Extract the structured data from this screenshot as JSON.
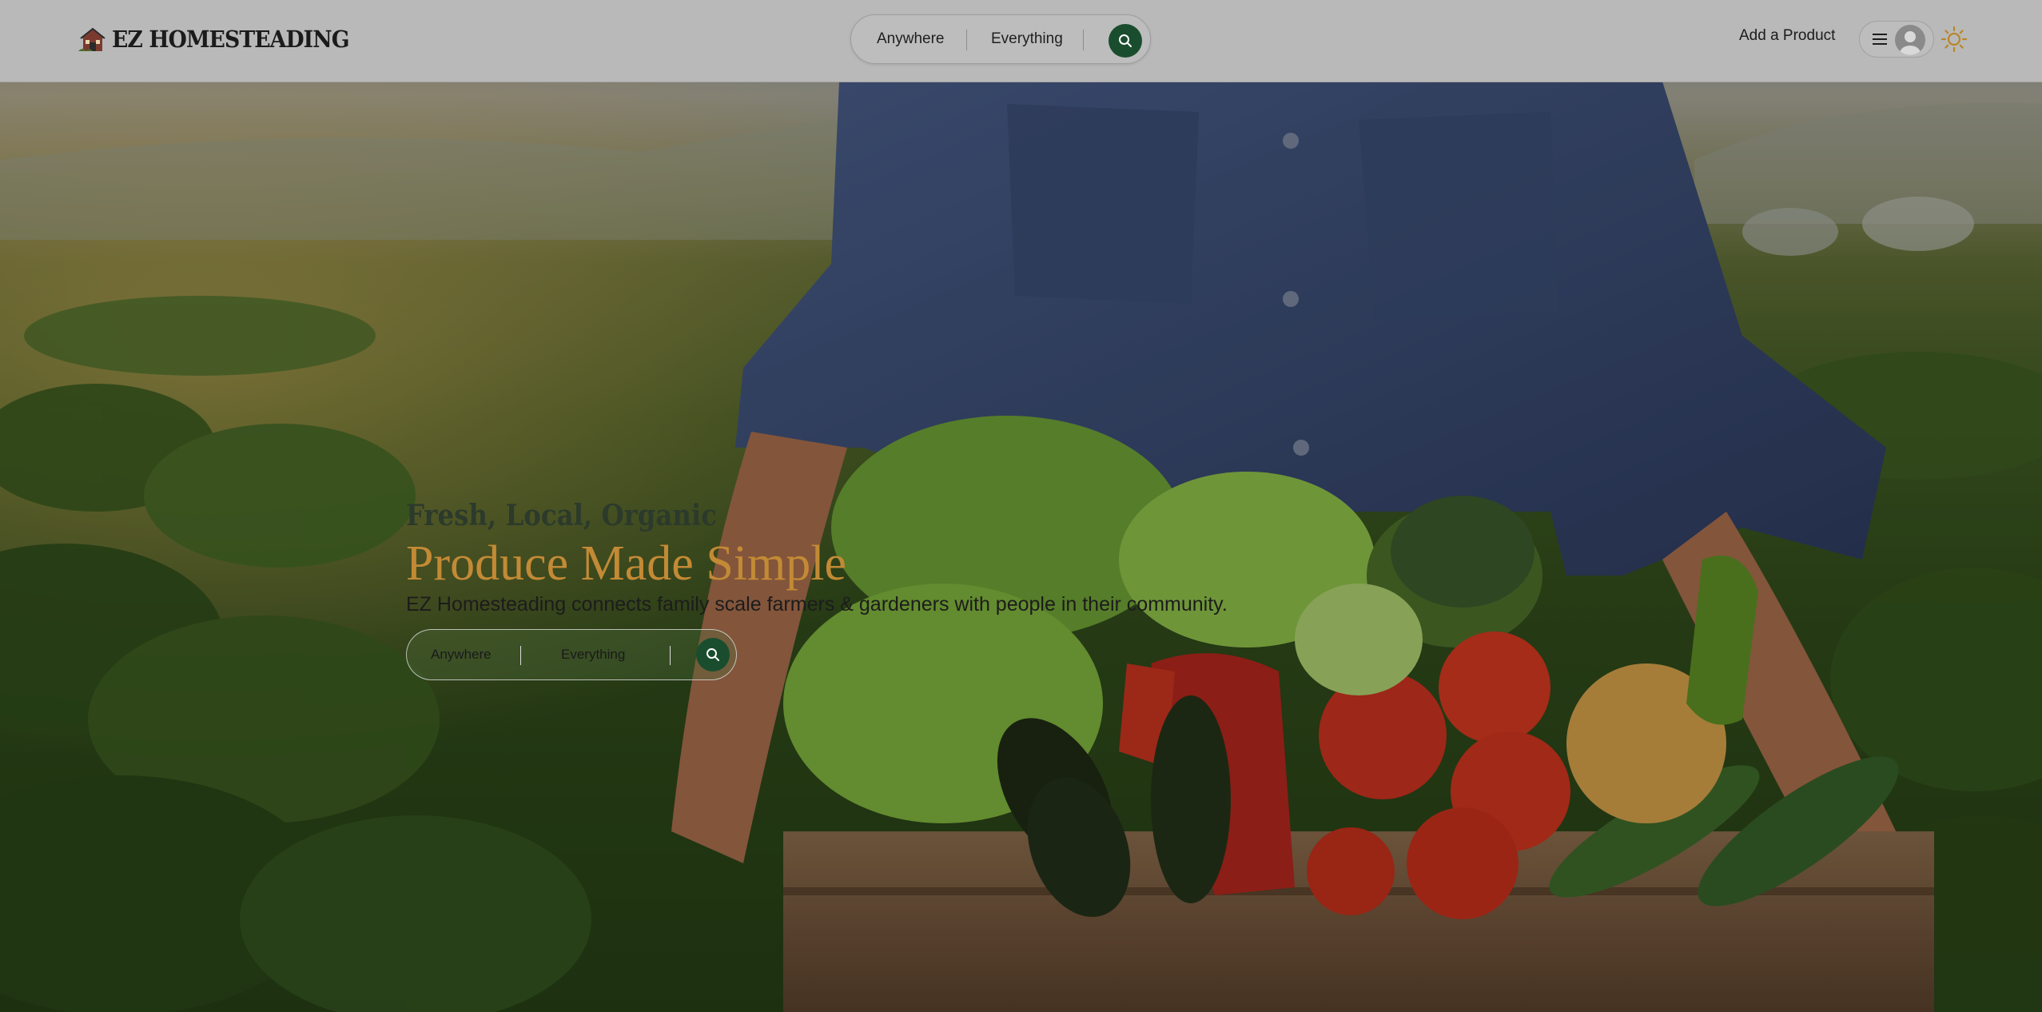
{
  "brand": {
    "name": "EZ HOMESTEADING",
    "logo_icon": "homestead-house-icon"
  },
  "nav_search": {
    "location": "Anywhere",
    "category": "Everything",
    "icon": "search-icon"
  },
  "header_actions": {
    "add_product": "Add a Product",
    "menu_icon": "hamburger-menu-icon",
    "avatar_icon": "user-avatar-icon",
    "theme_icon": "sun-icon"
  },
  "hero": {
    "tagline": "Fresh, Local, Organic",
    "headline": "Produce Made Simple",
    "description": "EZ Homesteading connects family scale farmers & gardeners with people in their community.",
    "search": {
      "location": "Anywhere",
      "category": "Everything",
      "icon": "search-icon"
    },
    "image_subject": "farmer-holding-vegetable-crate-photo"
  },
  "colors": {
    "brand_green": "#1a4d2e",
    "headline_gold": "#c38a35",
    "navbar_bg": "#b9b9b9",
    "theme_icon": "#b8862b"
  }
}
